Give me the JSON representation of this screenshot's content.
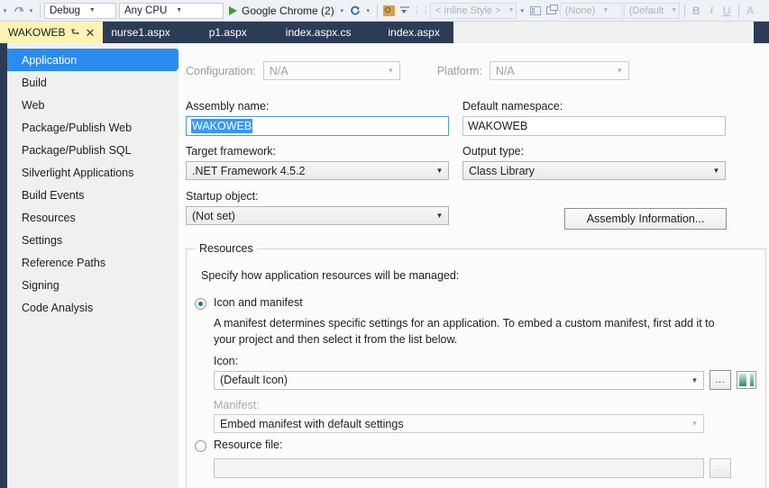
{
  "toolbar": {
    "undo_icon": "undo-arrow-icon",
    "redo_icon": "redo-arrow-icon",
    "config_value": "Debug",
    "platform_value": "Any CPU",
    "run_label": "Google Chrome (2)",
    "play_icon": "play-triangle-icon",
    "refresh_icon": "refresh-icon",
    "find_icon": "find-magnifier-icon",
    "indent_icon": "indent-icon",
    "style_value": "< Inline Style >",
    "block_icon": "block-format-icon",
    "float_icon": "float-window-icon",
    "target_rule_value": "(None)",
    "font_value": "(Default",
    "bold_label": "B",
    "italic_label": "I",
    "underline_label": "U",
    "fontcolor_label": "A"
  },
  "tabs": [
    {
      "label": "WAKOWEB",
      "active": true,
      "pin_icon": "pin-icon",
      "close_icon": "close-icon"
    },
    {
      "label": "nurse1.aspx",
      "active": false
    },
    {
      "label": "p1.aspx",
      "active": false
    },
    {
      "label": "index.aspx.cs",
      "active": false
    },
    {
      "label": "index.aspx",
      "active": false
    }
  ],
  "sidebar": {
    "items": [
      {
        "label": "Application",
        "selected": true
      },
      {
        "label": "Build",
        "selected": false
      },
      {
        "label": "Web",
        "selected": false
      },
      {
        "label": "Package/Publish Web",
        "selected": false
      },
      {
        "label": "Package/Publish SQL",
        "selected": false
      },
      {
        "label": "Silverlight Applications",
        "selected": false
      },
      {
        "label": "Build Events",
        "selected": false
      },
      {
        "label": "Resources",
        "selected": false
      },
      {
        "label": "Settings",
        "selected": false
      },
      {
        "label": "Reference Paths",
        "selected": false
      },
      {
        "label": "Signing",
        "selected": false
      },
      {
        "label": "Code Analysis",
        "selected": false
      }
    ]
  },
  "application": {
    "configuration_label": "Configuration:",
    "configuration_value": "N/A",
    "platform_label": "Platform:",
    "platform_value": "N/A",
    "assembly_name_label": "Assembly name:",
    "assembly_name_value": "WAKOWEB",
    "default_namespace_label": "Default namespace:",
    "default_namespace_value": "WAKOWEB",
    "target_framework_label": "Target framework:",
    "target_framework_value": ".NET Framework 4.5.2",
    "output_type_label": "Output type:",
    "output_type_value": "Class Library",
    "startup_object_label": "Startup object:",
    "startup_object_value": "(Not set)",
    "assembly_information_button": "Assembly Information..."
  },
  "resources": {
    "group_title": "Resources",
    "description": "Specify how application resources will be managed:",
    "icon_manifest_radio_label": "Icon and manifest",
    "icon_manifest_checked": true,
    "manifest_description": "A manifest determines specific settings for an application. To embed a custom manifest, first add it to your project and then select it from the list below.",
    "icon_label": "Icon:",
    "icon_value": "(Default Icon)",
    "icon_browse_label": "...",
    "icon_preview_name": "icon-preview-thumbnail",
    "manifest_label": "Manifest:",
    "manifest_value": "Embed manifest with default settings",
    "resource_file_radio_label": "Resource file:",
    "resource_file_checked": false,
    "resource_file_value": "",
    "resource_file_browse_label": "..."
  },
  "colors": {
    "accent_blue": "#2b8cf0",
    "tabstrip_navy": "#2d3c56",
    "active_tab_yellow": "#fdf3b4",
    "selection_blue": "#3399ff",
    "play_green": "#3f9c35"
  }
}
